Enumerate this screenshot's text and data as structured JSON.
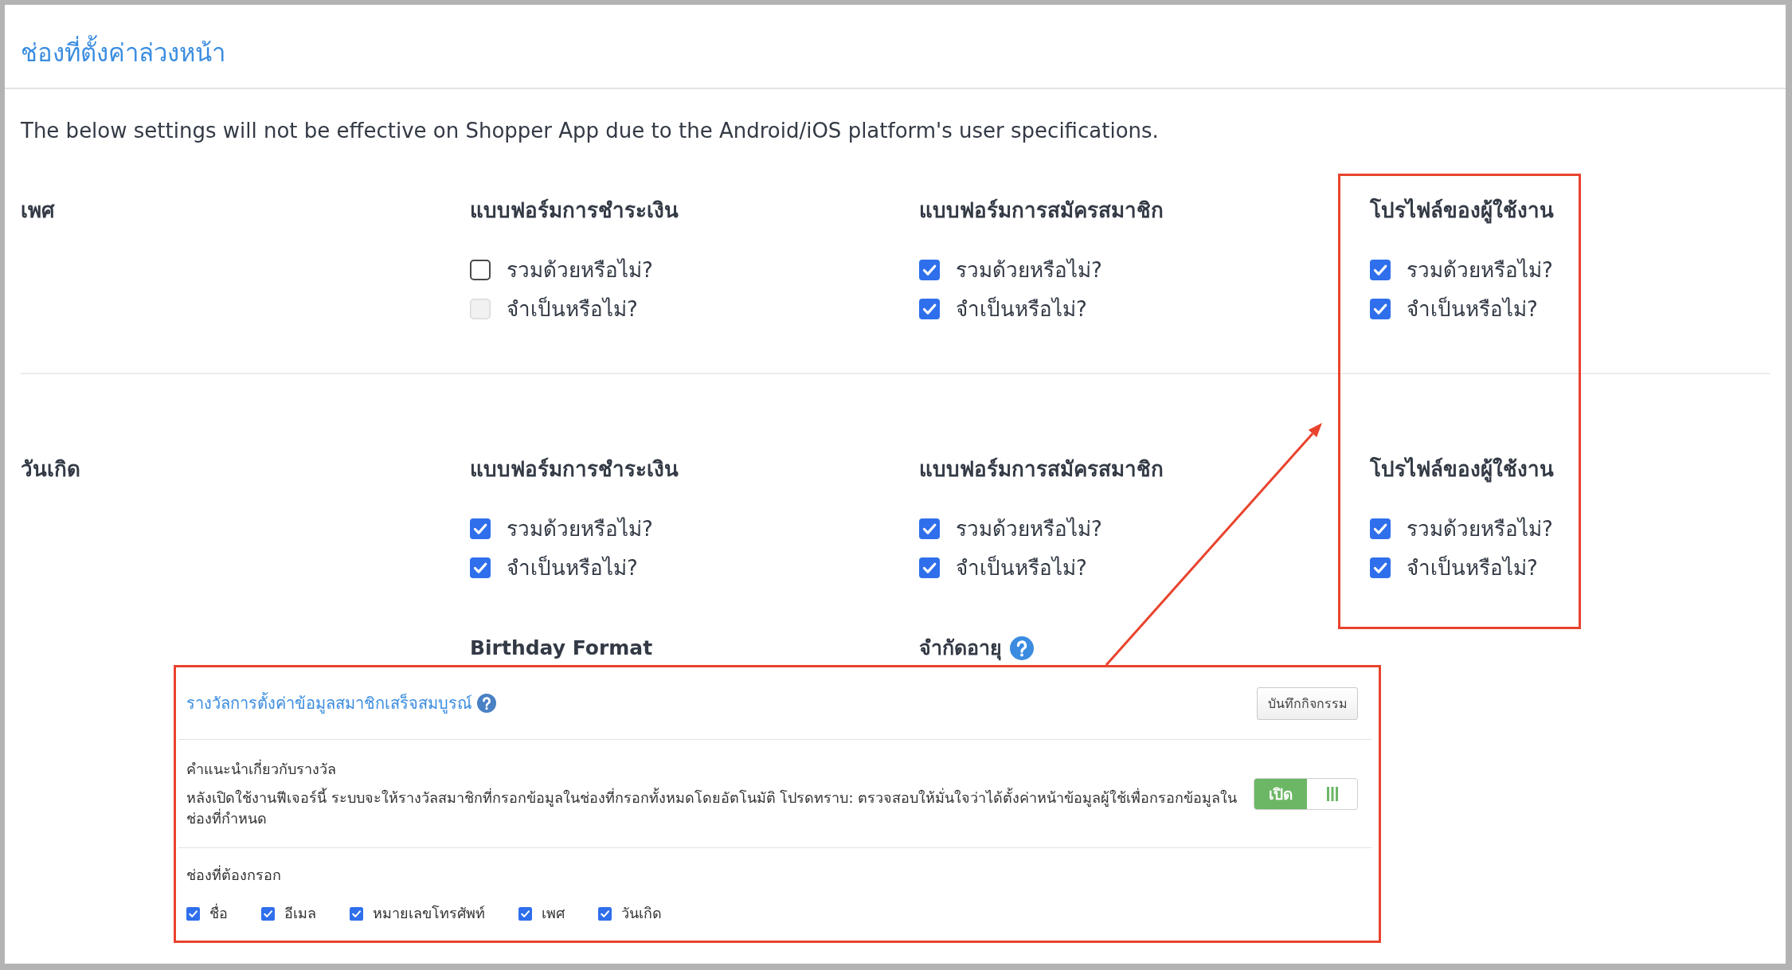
{
  "header": {
    "title": "ช่องที่ตั้งค่าล่วงหน้า"
  },
  "notice": "The below settings will not be effective on Shopper App due to the Android/iOS platform's user specifications.",
  "fields": [
    {
      "name": "เพศ",
      "groups": [
        {
          "title": "แบบฟอร์มการชำระเงิน",
          "options": [
            {
              "label": "รวมด้วยหรือไม่?",
              "checked": false,
              "disabled": false
            },
            {
              "label": "จำเป็นหรือไม่?",
              "checked": false,
              "disabled": true
            }
          ]
        },
        {
          "title": "แบบฟอร์มการสมัครสมาชิก",
          "options": [
            {
              "label": "รวมด้วยหรือไม่?",
              "checked": true,
              "disabled": false
            },
            {
              "label": "จำเป็นหรือไม่?",
              "checked": true,
              "disabled": false
            }
          ]
        },
        {
          "title": "โปรไฟล์ของผู้ใช้งาน",
          "options": [
            {
              "label": "รวมด้วยหรือไม่?",
              "checked": true,
              "disabled": false
            },
            {
              "label": "จำเป็นหรือไม่?",
              "checked": true,
              "disabled": false
            }
          ]
        }
      ]
    },
    {
      "name": "วันเกิด",
      "groups": [
        {
          "title": "แบบฟอร์มการชำระเงิน",
          "options": [
            {
              "label": "รวมด้วยหรือไม่?",
              "checked": true,
              "disabled": false
            },
            {
              "label": "จำเป็นหรือไม่?",
              "checked": true,
              "disabled": false
            }
          ]
        },
        {
          "title": "แบบฟอร์มการสมัครสมาชิก",
          "options": [
            {
              "label": "รวมด้วยหรือไม่?",
              "checked": true,
              "disabled": false
            },
            {
              "label": "จำเป็นหรือไม่?",
              "checked": true,
              "disabled": false
            }
          ]
        },
        {
          "title": "โปรไฟล์ของผู้ใช้งาน",
          "options": [
            {
              "label": "รวมด้วยหรือไม่?",
              "checked": true,
              "disabled": false
            },
            {
              "label": "จำเป็นหรือไม่?",
              "checked": true,
              "disabled": false
            }
          ]
        }
      ],
      "settings": [
        {
          "label": "Birthday Format",
          "help": false
        },
        {
          "label": "จำกัดอายุ",
          "help": true
        }
      ]
    }
  ],
  "popup": {
    "title": "รางวัลการตั้งค่าข้อมูลสมาชิกเสร็จสมบูรณ์",
    "help": true,
    "log_button": "บันทึกกิจกรรม",
    "hint_label": "คำแนะนำเกี่ยวกับรางวัล",
    "description": "หลังเปิดใช้งานฟีเจอร์นี้ ระบบจะให้รางวัลสมาชิกที่กรอกข้อมูลในช่องที่กรอกทั้งหมดโดยอัตโนมัติ โปรดทราบ: ตรวจสอบให้มั่นใจว่าได้ตั้งค่าหน้าข้อมูลผู้ใช้เพื่อกรอกข้อมูลในช่องที่กำหนด",
    "toggle": {
      "label": "เปิด",
      "on": true
    },
    "required_label": "ช่องที่ต้องกรอก",
    "required_fields": [
      {
        "label": "ชื่อ",
        "checked": true
      },
      {
        "label": "อีเมล",
        "checked": true
      },
      {
        "label": "หมายเลขโทรศัพท์",
        "checked": true
      },
      {
        "label": "เพศ",
        "checked": true
      },
      {
        "label": "วันเกิด",
        "checked": true
      }
    ]
  }
}
